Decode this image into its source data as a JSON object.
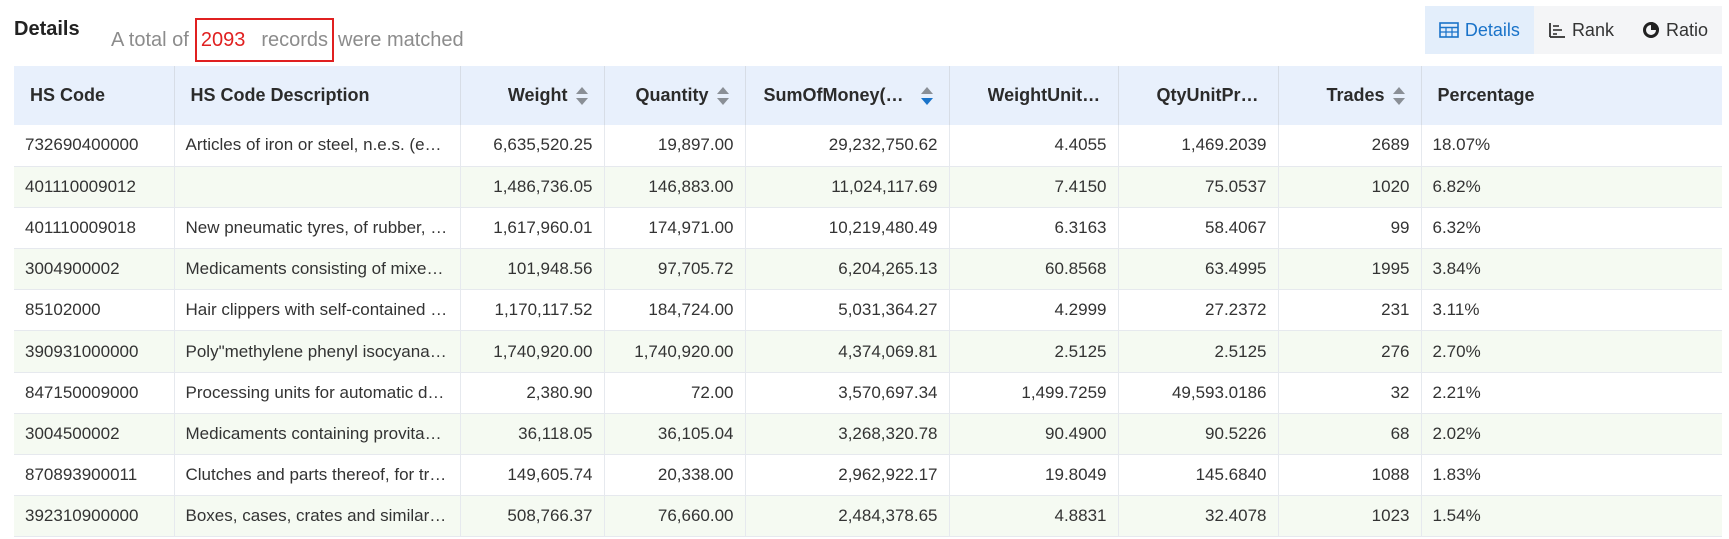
{
  "header": {
    "title": "Details",
    "summary_prefix": "A total of",
    "count": "2093",
    "records_word": "records",
    "summary_suffix": "were matched"
  },
  "views": [
    {
      "label": "Details",
      "icon": "table-icon",
      "active": true
    },
    {
      "label": "Rank",
      "icon": "rank-icon",
      "active": false
    },
    {
      "label": "Ratio",
      "icon": "pie-chart-icon",
      "active": false
    }
  ],
  "colors": {
    "accent": "#1a73c9",
    "highlight": "#e02020",
    "header_bg": "#e8f0fc",
    "stripe": "#f5faf2"
  },
  "table": {
    "columns": [
      {
        "label": "HS Code",
        "sortable": false
      },
      {
        "label": "HS Code Description",
        "sortable": false
      },
      {
        "label": "Weight",
        "sortable": true
      },
      {
        "label": "Quantity",
        "sortable": true
      },
      {
        "label": "SumOfMoney(U...",
        "sortable": true,
        "sorted": "desc"
      },
      {
        "label": "WeightUnitPrice",
        "sortable": false
      },
      {
        "label": "QtyUnitPrice",
        "sortable": false
      },
      {
        "label": "Trades",
        "sortable": true
      },
      {
        "label": "Percentage",
        "sortable": false
      }
    ],
    "rows": [
      [
        "732690400000",
        "Articles of iron or steel, n.e.s. (exc...",
        "6,635,520.25",
        "19,897.00",
        "29,232,750.62",
        "4.4055",
        "1,469.2039",
        "2689",
        "18.07%"
      ],
      [
        "401110009012",
        "",
        "1,486,736.05",
        "146,883.00",
        "11,024,117.69",
        "7.4150",
        "75.0537",
        "1020",
        "6.82%"
      ],
      [
        "401110009018",
        "New pneumatic tyres, of rubber, of...",
        "1,617,960.01",
        "174,971.00",
        "10,219,480.49",
        "6.3163",
        "58.4067",
        "99",
        "6.32%"
      ],
      [
        "3004900002",
        "Medicaments consisting of mixed ...",
        "101,948.56",
        "97,705.72",
        "6,204,265.13",
        "60.8568",
        "63.4995",
        "1995",
        "3.84%"
      ],
      [
        "85102000",
        "Hair clippers with self-contained el...",
        "1,170,117.52",
        "184,724.00",
        "5,031,364.27",
        "4.2999",
        "27.2372",
        "231",
        "3.11%"
      ],
      [
        "390931000000",
        "Poly\"methylene phenyl isocyanate...",
        "1,740,920.00",
        "1,740,920.00",
        "4,374,069.81",
        "2.5125",
        "2.5125",
        "276",
        "2.70%"
      ],
      [
        "847150009000",
        "Processing units for automatic dat...",
        "2,380.90",
        "72.00",
        "3,570,697.34",
        "1,499.7259",
        "49,593.0186",
        "32",
        "2.21%"
      ],
      [
        "3004500002",
        "Medicaments containing provitami...",
        "36,118.05",
        "36,105.04",
        "3,268,320.78",
        "90.4900",
        "90.5226",
        "68",
        "2.02%"
      ],
      [
        "870893900011",
        "Clutches and parts thereof, for tra...",
        "149,605.74",
        "20,338.00",
        "2,962,922.17",
        "19.8049",
        "145.6840",
        "1088",
        "1.83%"
      ],
      [
        "392310900000",
        "Boxes, cases, crates and similar ar...",
        "508,766.37",
        "76,660.00",
        "2,484,378.65",
        "4.8831",
        "32.4078",
        "1023",
        "1.54%"
      ]
    ]
  }
}
